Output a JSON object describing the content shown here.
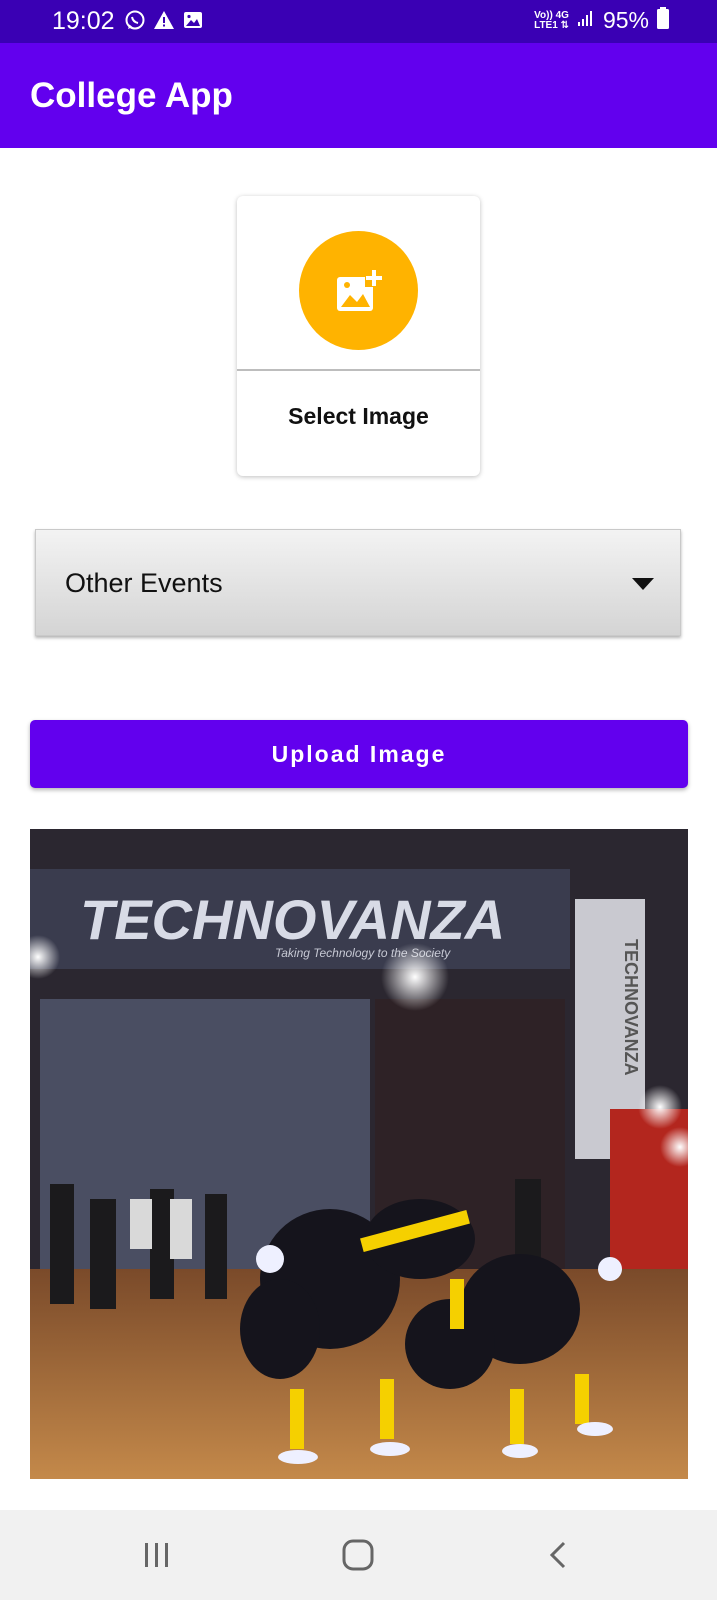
{
  "status_bar": {
    "time": "19:02",
    "left_icons": [
      "whatsapp-icon",
      "warning-icon",
      "image-icon"
    ],
    "network_top": "Vo)) 4G",
    "network_bottom": "LTE1 ⇅",
    "battery": "95%"
  },
  "app_bar": {
    "title": "College App"
  },
  "select_card": {
    "label": "Select Image",
    "icon": "add-photo-icon",
    "accent": "#ffb300"
  },
  "category_spinner": {
    "selected": "Other Events"
  },
  "upload_button": {
    "label": "Upload Image",
    "color": "#6200ee"
  },
  "preview_image": {
    "banner_text": "TECHNOVANZA",
    "banner_subtitle": "Taking Technology to the Society",
    "side_banner": "TECHNOVANZA"
  },
  "nav_bar": {
    "buttons": [
      "recent-apps-icon",
      "home-icon",
      "back-icon"
    ]
  }
}
